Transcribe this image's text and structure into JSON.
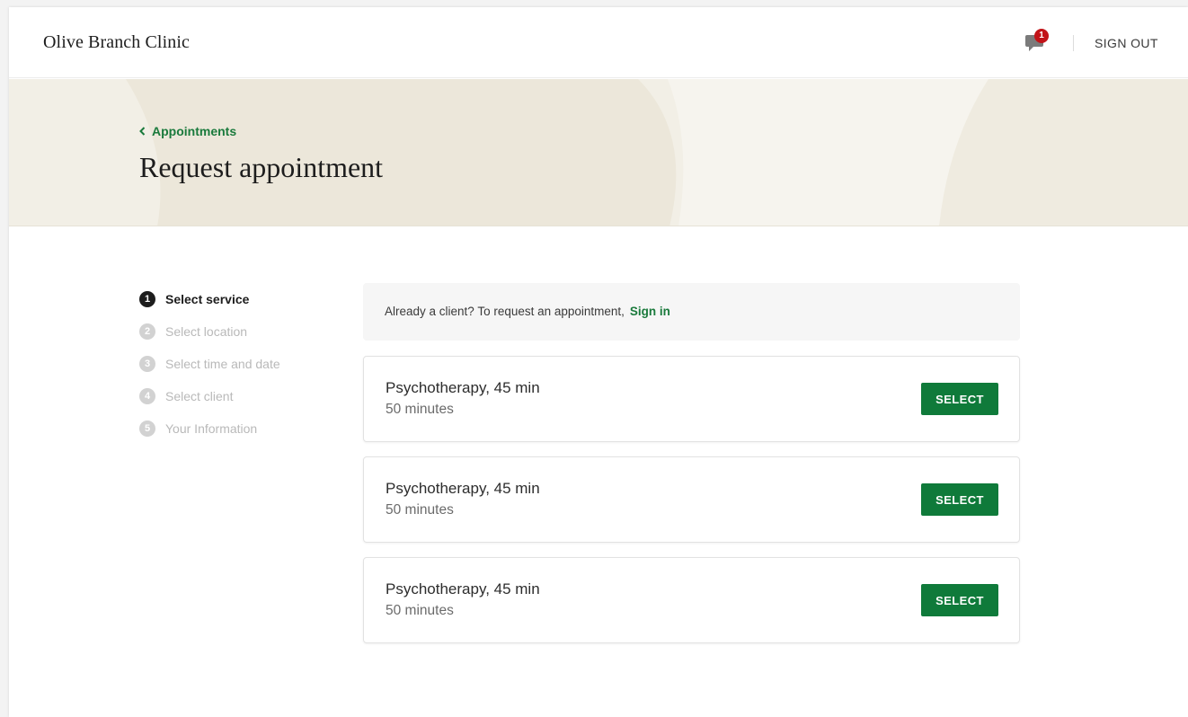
{
  "header": {
    "brand": "Olive Branch Clinic",
    "messages_badge": "1",
    "sign_out_label": "SIGN OUT"
  },
  "banner": {
    "back_label": "Appointments",
    "title": "Request appointment"
  },
  "steps": [
    {
      "num": "1",
      "label": "Select service",
      "active": true
    },
    {
      "num": "2",
      "label": "Select location",
      "active": false
    },
    {
      "num": "3",
      "label": "Select time and date",
      "active": false
    },
    {
      "num": "4",
      "label": "Select client",
      "active": false
    },
    {
      "num": "5",
      "label": "Your Information",
      "active": false
    }
  ],
  "notice": {
    "text": "Already a client? To request an appointment,",
    "link_label": "Sign in"
  },
  "services": [
    {
      "title": "Psychotherapy, 45 min",
      "duration": "50 minutes",
      "button": "SELECT"
    },
    {
      "title": "Psychotherapy, 45 min",
      "duration": "50 minutes",
      "button": "SELECT"
    },
    {
      "title": "Psychotherapy, 45 min",
      "duration": "50 minutes",
      "button": "SELECT"
    }
  ],
  "colors": {
    "accent_green": "#0f7a3a",
    "link_green": "#1a7a3c",
    "badge_red": "#c21318",
    "banner_bg": "#f2efe6"
  }
}
